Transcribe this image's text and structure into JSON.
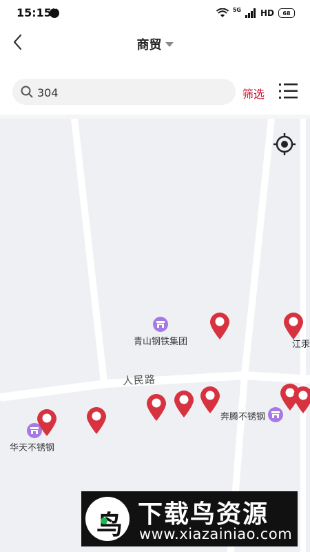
{
  "status_bar": {
    "time": "15:15",
    "network_type": "5G",
    "hd_label": "HD",
    "battery": "68"
  },
  "header": {
    "back_icon": "chevron-left-icon",
    "title": "商贸"
  },
  "search": {
    "value": "304",
    "filter_label": "筛选",
    "list_icon": "list-menu-icon"
  },
  "map": {
    "road_label": "人民路",
    "pois": [
      {
        "name": "青山钢铁集团"
      },
      {
        "name": "奔腾不锈钢"
      },
      {
        "name": "华天不锈钢"
      }
    ],
    "edge_label": "江汞",
    "marker_color": "#d7323f",
    "poi_color": "#a679e6"
  },
  "watermark": {
    "title": "下载鸟资源",
    "url": "www.xiazainiao.com"
  }
}
